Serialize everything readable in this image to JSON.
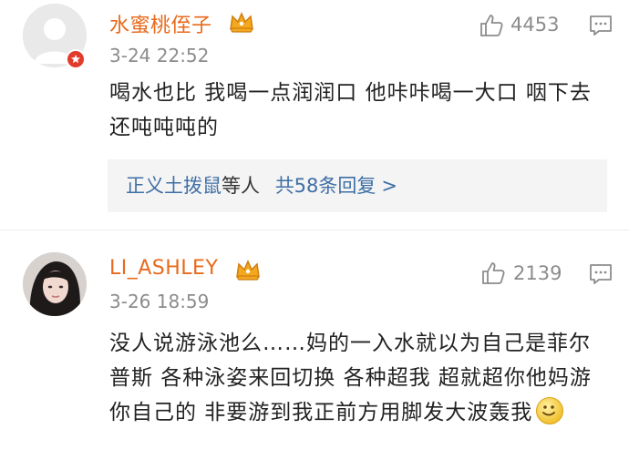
{
  "comments": [
    {
      "username": "水蜜桃侄子",
      "time": "3-24 22:52",
      "likes": "4453",
      "text": "喝水也比 我喝一点润润口 他咔咔喝一大口 咽下去还吨吨吨的",
      "reply_summary": {
        "user": "正义土拨鼠",
        "etc": "等人",
        "count_text": "共58条回复",
        "chevron": ">"
      }
    },
    {
      "username": "LI_ASHLEY",
      "time": "3-26 18:59",
      "likes": "2139",
      "text": "没人说游泳池么……妈的一入水就以为自己是菲尔普斯 各种泳姿来回切换 各种超我 超就超你他妈游你自己的 非要游到我正前方用脚发大波轰我"
    }
  ],
  "colors": {
    "username": "#e86a1c",
    "link": "#3f6fa5",
    "meta": "#8c8c8c",
    "text": "#222222",
    "reply_bg": "#f4f4f4"
  },
  "icons": {
    "crown": "crown-icon",
    "like": "thumbs-up-icon",
    "reply": "comment-icon",
    "verified": "verified-badge-icon",
    "emoji": "smile-emoji-icon"
  }
}
